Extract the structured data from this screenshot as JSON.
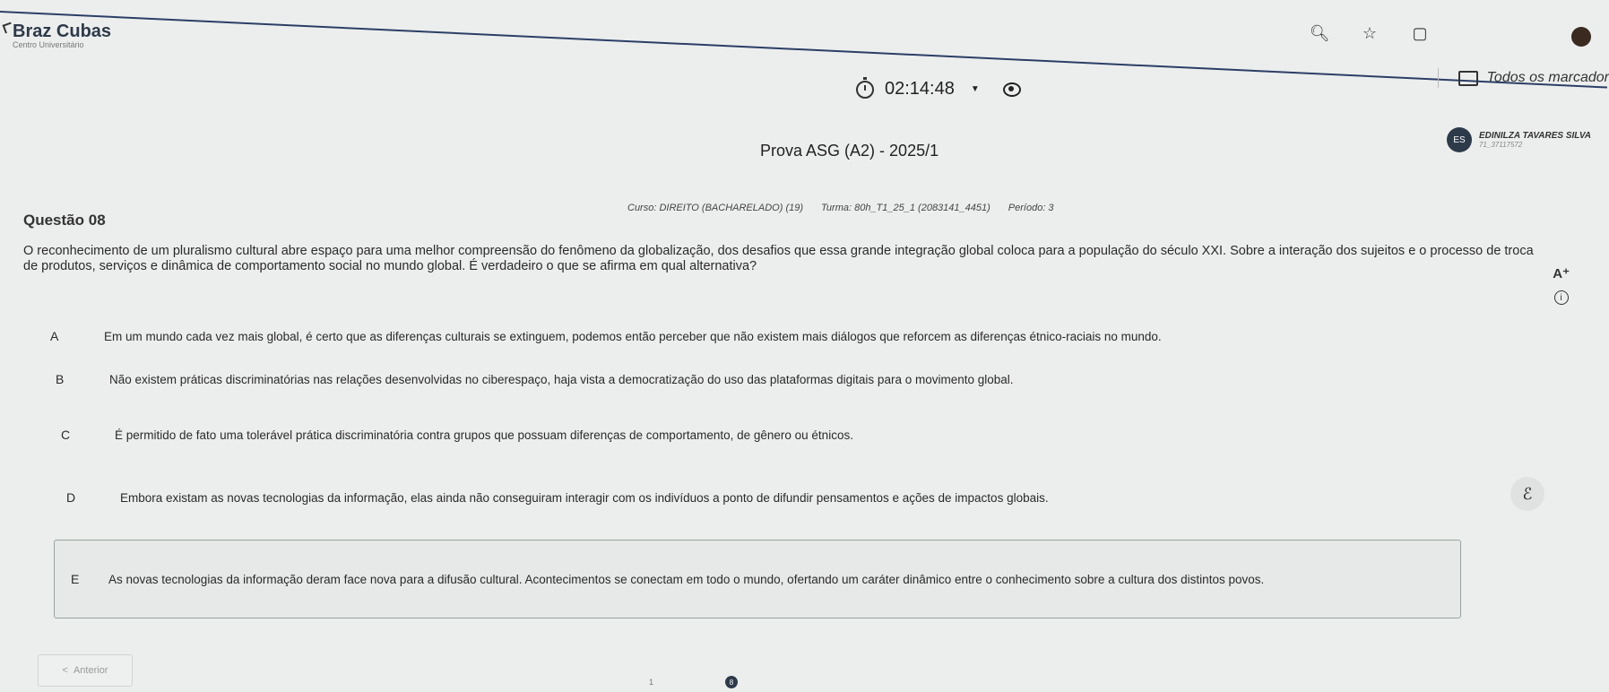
{
  "brand": {
    "name": "Braz Cubas",
    "subtitle": "Centro Universitário"
  },
  "browser": {
    "icons": [
      "search-icon",
      "star-icon",
      "extension-icon",
      "profile-icon"
    ],
    "bookmarks_label": "Todos os marcador"
  },
  "timer": {
    "value": "02:14:48"
  },
  "user": {
    "initials": "ES",
    "name": "EDINILZA TAVARES SILVA",
    "id": "71_37117572"
  },
  "exam": {
    "title": "Prova ASG (A2) - 2025/1",
    "course": "Curso: DIREITO (BACHARELADO) (19)",
    "class": "Turma: 80h_T1_25_1 (2083141_4451)",
    "period": "Período: 3"
  },
  "question": {
    "label": "Questão 08",
    "statement": "O reconhecimento de um pluralismo cultural abre espaço para uma melhor compreensão do fenômeno da globalização, dos desafios que essa grande integração global coloca para a população do século XXI. Sobre a interação dos sujeitos e o processo de troca de produtos, serviços e dinâmica de comportamento social no mundo global. É verdadeiro o que se afirma em qual alternativa?",
    "options": [
      {
        "letter": "A",
        "text": "Em um mundo cada vez mais global, é certo que as diferenças culturais se extinguem, podemos então perceber que não existem mais diálogos que reforcem as diferenças étnico-raciais no mundo."
      },
      {
        "letter": "B",
        "text": "Não existem práticas discriminatórias nas relações desenvolvidas no ciberespaço, haja vista a democratização do uso das plataformas digitais para o movimento global."
      },
      {
        "letter": "C",
        "text": "É permitido de fato uma tolerável prática discriminatória contra grupos que possuam diferenças de comportamento, de gênero ou étnicos."
      },
      {
        "letter": "D",
        "text": "Embora existam as novas tecnologias da informação, elas ainda não conseguiram interagir com os indivíduos a ponto de difundir pensamentos e ações de impactos globais."
      },
      {
        "letter": "E",
        "text": "As novas tecnologias da informação deram face nova para a difusão cultural. Acontecimentos se conectam em todo o mundo, ofertando um caráter dinâmico entre o conhecimento sobre a cultura dos distintos povos."
      }
    ],
    "selected": "E"
  },
  "tools": {
    "font_size_label": "A⁺",
    "info_label": "i",
    "help_label": "ℰ"
  },
  "nav": {
    "prev_label": "Anterior",
    "prev_arrow": "<",
    "pages": [
      "1",
      "8"
    ]
  },
  "colors": {
    "brand_navy": "#2d3a4a",
    "background": "#eceeed"
  }
}
